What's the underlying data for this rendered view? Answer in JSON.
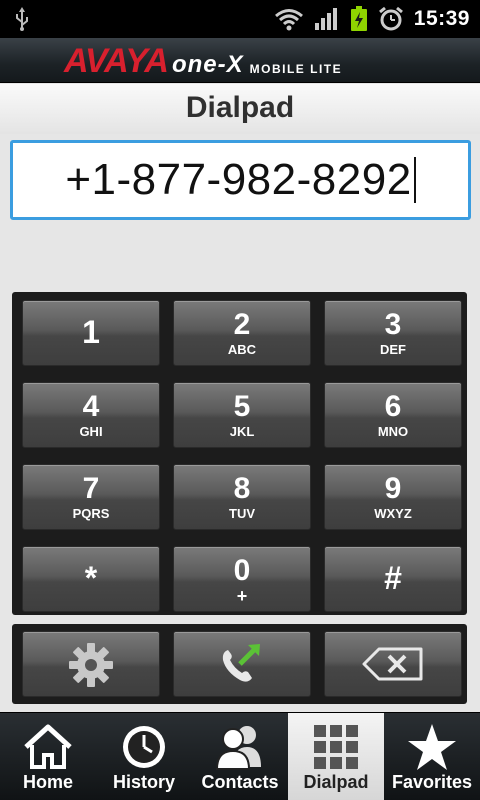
{
  "status_bar": {
    "time": "15:39",
    "icons": [
      "usb-icon",
      "wifi-icon",
      "signal-icon",
      "battery-charging-icon",
      "alarm-icon"
    ]
  },
  "brand": {
    "avaya": "AVAYA",
    "onex": "one-X",
    "mobile_lite": "MOBILE LITE"
  },
  "screen_title": "Dialpad",
  "dial_input": {
    "value": "+1-877-982-8292"
  },
  "keys": [
    {
      "digit": "1",
      "letters": ""
    },
    {
      "digit": "2",
      "letters": "ABC"
    },
    {
      "digit": "3",
      "letters": "DEF"
    },
    {
      "digit": "4",
      "letters": "GHI"
    },
    {
      "digit": "5",
      "letters": "JKL"
    },
    {
      "digit": "6",
      "letters": "MNO"
    },
    {
      "digit": "7",
      "letters": "PQRS"
    },
    {
      "digit": "8",
      "letters": "TUV"
    },
    {
      "digit": "9",
      "letters": "WXYZ"
    },
    {
      "digit": "*",
      "letters": ""
    },
    {
      "digit": "0",
      "letters": "+"
    },
    {
      "digit": "#",
      "letters": ""
    }
  ],
  "actions": [
    "settings-icon",
    "call-icon",
    "backspace-icon"
  ],
  "colors": {
    "accent": "#3b9de0",
    "brand_red": "#d8202e",
    "call_green": "#5bc236",
    "battery_green": "#8fd400"
  },
  "bottom_nav": [
    {
      "label": "Home",
      "icon": "home-icon",
      "active": false
    },
    {
      "label": "History",
      "icon": "clock-icon",
      "active": false
    },
    {
      "label": "Contacts",
      "icon": "contacts-icon",
      "active": false
    },
    {
      "label": "Dialpad",
      "icon": "dialpad-icon",
      "active": true
    },
    {
      "label": "Favorites",
      "icon": "star-icon",
      "active": false
    }
  ]
}
